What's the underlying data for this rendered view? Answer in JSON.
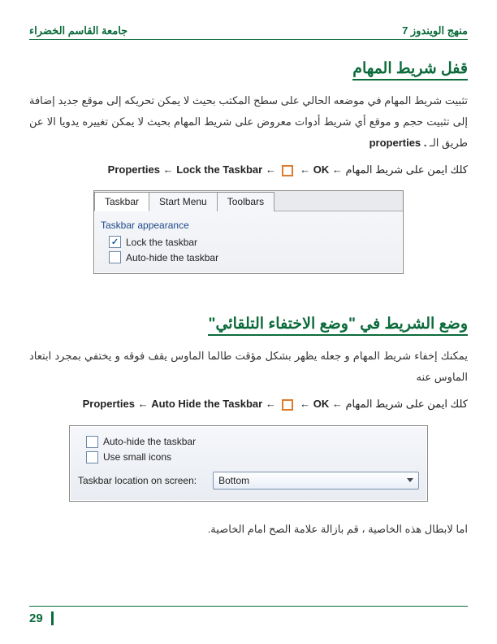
{
  "header": {
    "left": "جامعة القاسم الخضراء",
    "right": "منهج الويندوز 7"
  },
  "s1": {
    "title": "قفل شريط المهام",
    "para": "تثبيت شريط المهام في موضعه الحالي على سطح المكتب بحيث لا يمكن تحريكه إلى موقع جديد إضافة إلى تثبيت حجم و موقع أي شريط أدوات معروض على شريط المهام بحيث لا يمكن تغييره يدويا الا عن طريق الـ",
    "prop": "properties .",
    "step_ar1": "كلك ايمن على شريط المهام ←",
    "step_en1": "Properties",
    "arrow": "←",
    "step_en2": "Lock the Taskbar",
    "step_en3": "OK",
    "shot": {
      "tabs": [
        "Taskbar",
        "Start Menu",
        "Toolbars"
      ],
      "group": "Taskbar appearance",
      "ck1": "Lock the taskbar",
      "ck2": "Auto-hide the taskbar"
    }
  },
  "s2": {
    "title": "وضع الشريط في \"وضع الاختفاء التلقائي\"",
    "para": "يمكنك إخفاء شريط المهام و جعله يظهر بشكل مؤقت طالما الماوس يقف فوقه و يختفي بمجرد ابتعاد الماوس عنه",
    "step_ar1": "كلك ايمن على شريط المهام ←",
    "step_en1": "Properties",
    "arrow": "←",
    "step_en2": "Auto Hide the Taskbar",
    "step_en3": "OK",
    "shot": {
      "ck1": "Auto-hide the taskbar",
      "ck2": "Use small icons",
      "loc_lbl": "Taskbar location on screen:",
      "loc_val": "Bottom"
    },
    "note": "اما لابطال هذه الخاصية ، قم بازالة علامة الصح امام الخاصية."
  },
  "page_no": "29"
}
